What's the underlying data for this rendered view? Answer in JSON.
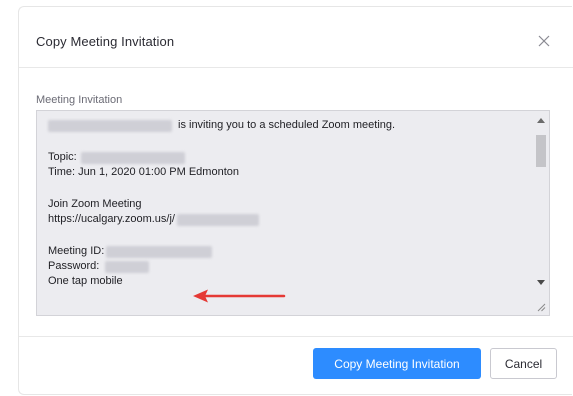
{
  "dialog": {
    "title": "Copy Meeting Invitation",
    "close_icon": "close-icon"
  },
  "invitation": {
    "label": "Meeting Invitation",
    "inviting_text": "is inviting you to a scheduled Zoom meeting.",
    "topic_label": "Topic:",
    "time_line": "Time: Jun 1, 2020 01:00 PM Edmonton",
    "join_line": "Join Zoom Meeting",
    "url_prefix": "https://ucalgary.zoom.us/j/",
    "meeting_id_label": "Meeting ID:",
    "password_label": "Password:",
    "one_tap_line": "One tap mobile"
  },
  "annotation": {
    "arrow_color": "#e53935"
  },
  "footer": {
    "copy_button": "Copy Meeting Invitation",
    "cancel_button": "Cancel"
  },
  "colors": {
    "primary": "#2d8cff",
    "textarea_bg": "#ececf0"
  }
}
